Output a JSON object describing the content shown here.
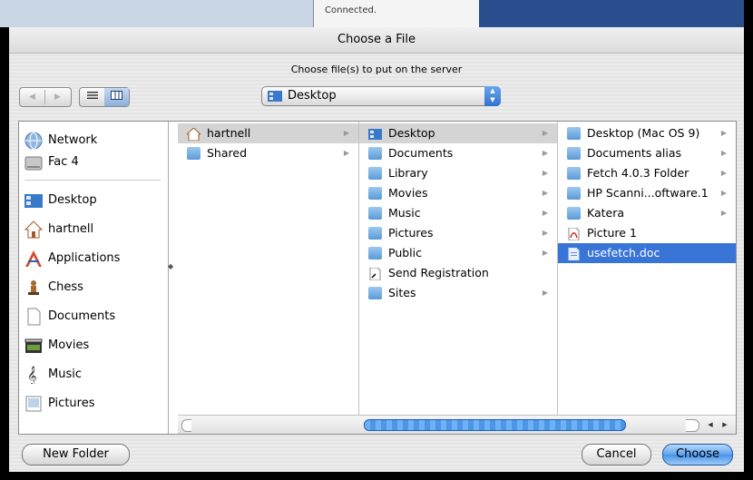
{
  "background": {
    "connection_status": "Connected."
  },
  "dialog": {
    "title": "Choose a File",
    "prompt": "Choose file(s) to put on the server",
    "nav": {
      "back_icon": "back-arrow-icon",
      "forward_icon": "forward-arrow-icon"
    },
    "view": {
      "list_icon": "list-view-icon",
      "column_icon": "column-view-icon",
      "selected": "column"
    },
    "location": {
      "label": "Desktop",
      "icon": "desktop-icon"
    },
    "sidebar": {
      "devices": [
        {
          "label": "Network",
          "icon": "network-globe-icon"
        },
        {
          "label": "Fac 4",
          "icon": "hard-drive-icon"
        }
      ],
      "places": [
        {
          "label": "Desktop",
          "icon": "desktop-icon"
        },
        {
          "label": "hartnell",
          "icon": "home-icon"
        },
        {
          "label": "Applications",
          "icon": "applications-icon"
        },
        {
          "label": "Chess",
          "icon": "chess-icon"
        },
        {
          "label": "Documents",
          "icon": "documents-icon"
        },
        {
          "label": "Movies",
          "icon": "movies-icon"
        },
        {
          "label": "Music",
          "icon": "music-icon"
        },
        {
          "label": "Pictures",
          "icon": "pictures-icon"
        }
      ]
    },
    "columns": [
      {
        "items": [
          {
            "label": "hartnell",
            "icon": "home-icon",
            "state": "path",
            "has_children": true
          },
          {
            "label": "Shared",
            "icon": "folder-icon",
            "state": "",
            "has_children": true
          }
        ]
      },
      {
        "items": [
          {
            "label": "Desktop",
            "icon": "desktop-icon",
            "state": "path",
            "has_children": true
          },
          {
            "label": "Documents",
            "icon": "folder-icon",
            "state": "",
            "has_children": true
          },
          {
            "label": "Library",
            "icon": "library-folder-icon",
            "state": "",
            "has_children": true
          },
          {
            "label": "Movies",
            "icon": "movies-folder-icon",
            "state": "",
            "has_children": true
          },
          {
            "label": "Music",
            "icon": "music-folder-icon",
            "state": "",
            "has_children": true
          },
          {
            "label": "Pictures",
            "icon": "pictures-folder-icon",
            "state": "",
            "has_children": true
          },
          {
            "label": "Public",
            "icon": "public-folder-icon",
            "state": "",
            "has_children": true
          },
          {
            "label": "Send Registration",
            "icon": "alias-file-icon",
            "state": "",
            "has_children": false
          },
          {
            "label": "Sites",
            "icon": "sites-folder-icon",
            "state": "",
            "has_children": true
          }
        ]
      },
      {
        "items": [
          {
            "label": "Desktop (Mac OS 9)",
            "icon": "alias-folder-icon",
            "state": "",
            "has_children": true
          },
          {
            "label": "Documents alias",
            "icon": "alias-folder-icon",
            "state": "",
            "has_children": true
          },
          {
            "label": "Fetch 4.0.3 Folder",
            "icon": "folder-icon",
            "state": "",
            "has_children": true
          },
          {
            "label": "HP Scanni...oftware.1",
            "icon": "folder-icon",
            "state": "",
            "has_children": true
          },
          {
            "label": "Katera",
            "icon": "folder-icon",
            "state": "",
            "has_children": true
          },
          {
            "label": "Picture 1",
            "icon": "pdf-icon",
            "state": "",
            "has_children": false
          },
          {
            "label": "usefetch.doc",
            "icon": "document-icon",
            "state": "selected",
            "has_children": false
          }
        ]
      }
    ],
    "buttons": {
      "new_folder": "New Folder",
      "cancel": "Cancel",
      "choose": "Choose"
    },
    "colors": {
      "selection": "#3875d7",
      "path_highlight": "#d4d4d4",
      "default_button": "#5fa3ef"
    }
  }
}
